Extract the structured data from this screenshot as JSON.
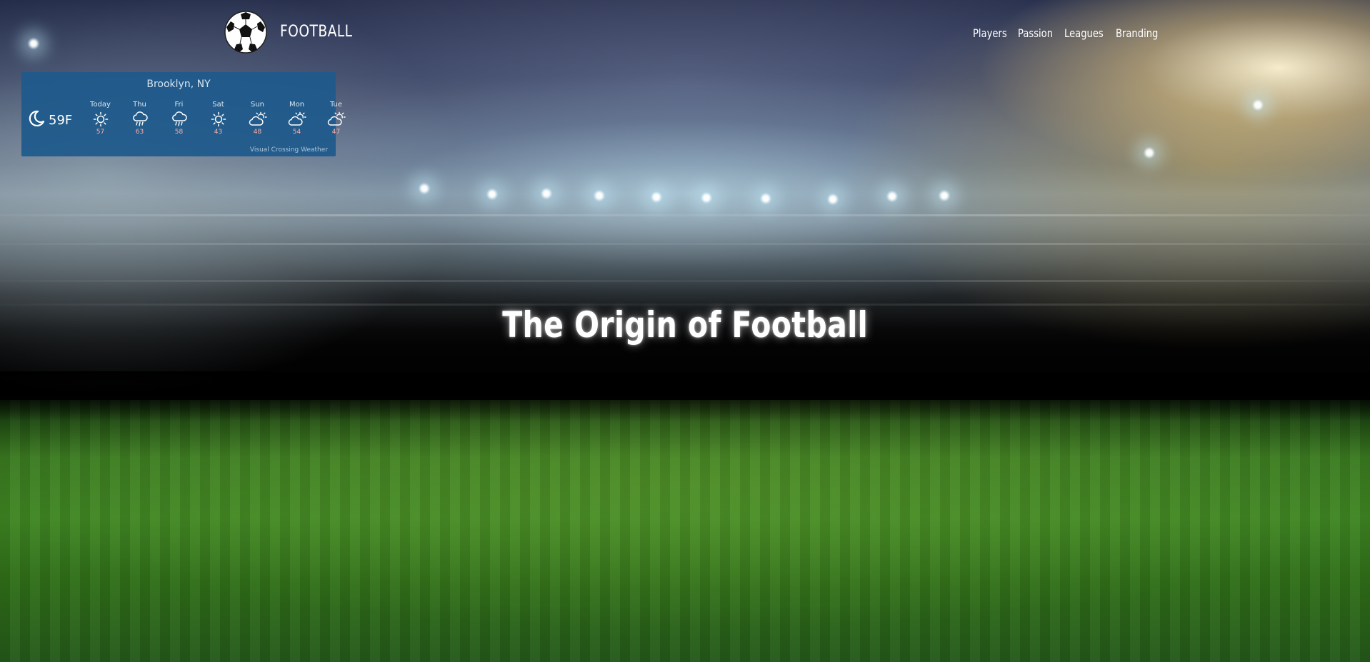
{
  "header": {
    "brand": "FOOTBALL",
    "nav": [
      {
        "label": "Players"
      },
      {
        "label": "Passion"
      },
      {
        "label": "Leagues"
      },
      {
        "label": "Branding"
      }
    ]
  },
  "weather": {
    "location": "Brooklyn, NY",
    "current_temp": "59F",
    "current_icon": "clear-night-icon",
    "days": [
      {
        "name": "Today",
        "icon": "sunny-icon",
        "high": "57"
      },
      {
        "name": "Thu",
        "icon": "rain-icon",
        "high": "63"
      },
      {
        "name": "Fri",
        "icon": "rain-icon",
        "high": "58"
      },
      {
        "name": "Sat",
        "icon": "sunny-icon",
        "high": "43"
      },
      {
        "name": "Sun",
        "icon": "partly-cloudy-icon",
        "high": "48"
      },
      {
        "name": "Mon",
        "icon": "partly-cloudy-icon",
        "high": "54"
      },
      {
        "name": "Tue",
        "icon": "partly-cloudy-icon",
        "high": "47"
      }
    ],
    "credit": "Visual Crossing Weather",
    "colors": {
      "panel": "#1e5a8c",
      "high_temp": "#ffb0a8"
    }
  },
  "hero": {
    "title": "The Origin of Football"
  }
}
